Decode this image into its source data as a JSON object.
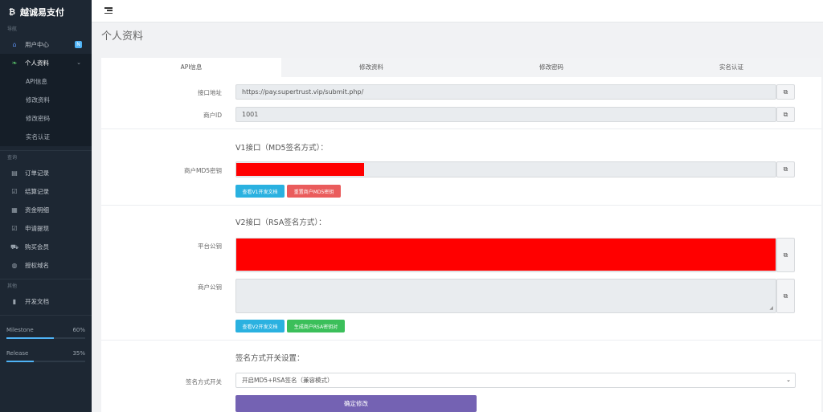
{
  "brand": {
    "name": "越诚易支付"
  },
  "sidebar": {
    "sections": {
      "nav": "导航",
      "query": "查询",
      "other": "其他"
    },
    "user_center": {
      "label": "用户中心",
      "badge": "N"
    },
    "profile": {
      "label": "个人资料",
      "children": [
        "API信息",
        "修改资料",
        "修改密码",
        "实名认证"
      ]
    },
    "query_items": [
      "订单记录",
      "结算记录",
      "资金明细",
      "申请提现",
      "购买会员",
      "授权域名"
    ],
    "other_items": [
      "开发文档"
    ],
    "progress": [
      {
        "label": "Milestone",
        "value_text": "60%",
        "value": 60
      },
      {
        "label": "Release",
        "value_text": "35%",
        "value": 35
      }
    ]
  },
  "page": {
    "title": "个人资料"
  },
  "tabs": [
    "API信息",
    "修改资料",
    "修改密码",
    "实名认证"
  ],
  "api": {
    "endpoint_label": "接口地址",
    "endpoint_value": "https://pay.supertrust.vip/submit.php/",
    "merchant_id_label": "商户ID",
    "merchant_id_value": "1001"
  },
  "v1": {
    "title": "V1接口（MD5签名方式）：",
    "md5_label": "商户MD5密钥",
    "btn_docs": "查看V1开发文档",
    "btn_reset": "重置商户MD5密钥"
  },
  "v2": {
    "title": "V2接口（RSA签名方式）：",
    "platform_key_label": "平台公钥",
    "merchant_key_label": "商户公钥",
    "btn_docs": "查看V2开发文档",
    "btn_generate": "生成商户RSA密钥对"
  },
  "sign": {
    "title": "签名方式开关设置：",
    "switch_label": "签名方式开关",
    "switch_value": "开启MD5+RSA签名（兼容模式）",
    "submit": "确定修改"
  },
  "colors": {
    "sidebar_bg": "#1d2733",
    "accent_purple": "#7462b3",
    "redacted": "#ff0000"
  }
}
